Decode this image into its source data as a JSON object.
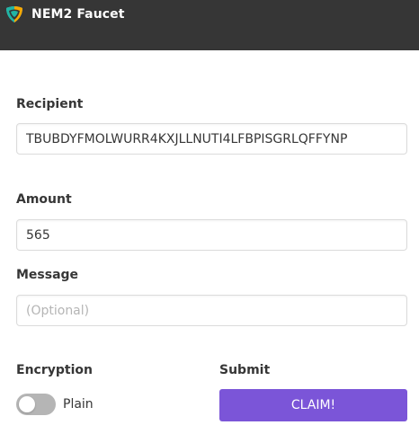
{
  "navbar": {
    "title": "NEM2 Faucet",
    "logo_icon": "nem-logo-icon",
    "background": "#363636"
  },
  "form": {
    "recipient": {
      "label": "Recipient",
      "value": "TBUBDYFMOLWURR4KXJLLNUTI4LFBPISGRLQFFYNP"
    },
    "amount": {
      "label": "Amount",
      "value": "565"
    },
    "message": {
      "label": "Message",
      "value": "",
      "placeholder": "(Optional)"
    },
    "encryption": {
      "label": "Encryption",
      "toggle_on": false,
      "toggle_text": "Plain"
    },
    "submit": {
      "label": "Submit",
      "button_label": "CLAIM!",
      "button_color": "#7b55d8"
    }
  }
}
